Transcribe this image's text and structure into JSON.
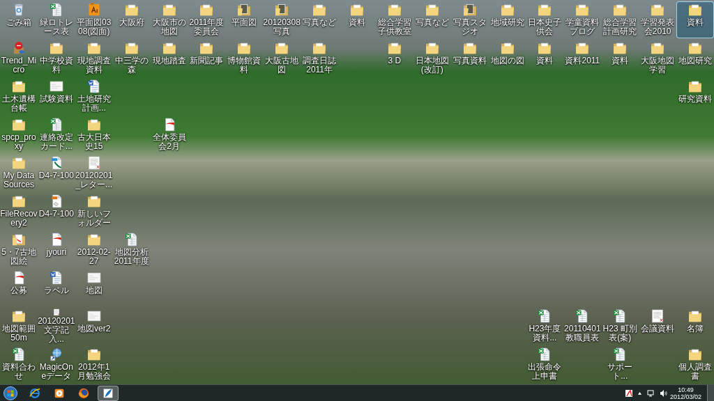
{
  "desktop": {
    "rows": [
      [
        {
          "kind": "recycle-bin",
          "label": "ごみ箱",
          "selected": false
        },
        {
          "kind": "excel",
          "label": "緑ロトレース表",
          "selected": false
        },
        {
          "kind": "illustrator",
          "label": "平面図0308(図面)",
          "selected": false
        },
        {
          "kind": "folder",
          "label": "大阪府",
          "selected": false
        },
        {
          "kind": "folder",
          "label": "大阪市の地図",
          "selected": false
        },
        {
          "kind": "folder",
          "label": "2011年度委員会",
          "selected": false
        },
        {
          "kind": "photo-folder",
          "label": "平面図",
          "selected": false
        },
        {
          "kind": "photo-folder",
          "label": "20120308写真",
          "selected": false
        },
        {
          "kind": "folder",
          "label": "写真など",
          "selected": false
        },
        {
          "kind": "folder",
          "label": "資料",
          "selected": false
        },
        {
          "kind": "folder",
          "label": "総合学習子供教室",
          "selected": false
        },
        {
          "kind": "folder",
          "label": "写真など",
          "selected": false
        },
        {
          "kind": "photo-folder",
          "label": "写真スタジオ",
          "selected": false
        },
        {
          "kind": "folder",
          "label": "地域研究",
          "selected": false
        },
        {
          "kind": "folder",
          "label": "日本史子供会",
          "selected": false
        },
        {
          "kind": "folder",
          "label": "学童資料ブログ",
          "selected": false
        },
        {
          "kind": "folder",
          "label": "総合学習計画研究",
          "selected": false
        },
        {
          "kind": "folder",
          "label": "学習発表会2010",
          "selected": false
        },
        {
          "kind": "folder",
          "label": "資料",
          "selected": true
        }
      ],
      [
        {
          "kind": "installer",
          "label": "Trend_Micro",
          "selected": false
        },
        {
          "kind": "folder",
          "label": "中学校資料",
          "selected": false
        },
        {
          "kind": "folder",
          "label": "現地調査資料",
          "selected": false
        },
        {
          "kind": "folder",
          "label": "中三学の森",
          "selected": false
        },
        {
          "kind": "folder",
          "label": "現地踏査",
          "selected": false
        },
        {
          "kind": "folder",
          "label": "新聞記事",
          "selected": false
        },
        {
          "kind": "folder",
          "label": "博物館資料",
          "selected": false
        },
        {
          "kind": "folder",
          "label": "大阪古地図",
          "selected": false
        },
        {
          "kind": "folder",
          "label": "調査日誌2011年",
          "selected": false
        },
        {
          "kind": "empty"
        },
        {
          "kind": "folder",
          "label": "3 D",
          "selected": false
        },
        {
          "kind": "folder",
          "label": "日本地図(改訂)",
          "selected": false
        },
        {
          "kind": "folder",
          "label": "写真資料",
          "selected": false
        },
        {
          "kind": "folder",
          "label": "地図の図",
          "selected": false
        },
        {
          "kind": "folder",
          "label": "資料",
          "selected": false
        },
        {
          "kind": "folder",
          "label": "資料2011",
          "selected": false
        },
        {
          "kind": "folder",
          "label": "資料",
          "selected": false
        },
        {
          "kind": "folder",
          "label": "大阪地図学習",
          "selected": false
        },
        {
          "kind": "folder",
          "label": "地図研究",
          "selected": false
        }
      ],
      [
        {
          "kind": "folder",
          "label": "土木遺構台帳",
          "selected": false
        },
        {
          "kind": "image",
          "label": "試験資料",
          "selected": false
        },
        {
          "kind": "word",
          "label": "土地研究計画...",
          "selected": false
        },
        {
          "kind": "empty"
        },
        {
          "kind": "empty"
        },
        {
          "kind": "empty"
        },
        {
          "kind": "empty"
        },
        {
          "kind": "empty"
        },
        {
          "kind": "empty"
        },
        {
          "kind": "empty"
        },
        {
          "kind": "empty"
        },
        {
          "kind": "empty"
        },
        {
          "kind": "empty"
        },
        {
          "kind": "empty"
        },
        {
          "kind": "empty"
        },
        {
          "kind": "empty"
        },
        {
          "kind": "empty"
        },
        {
          "kind": "empty"
        },
        {
          "kind": "folder",
          "label": "研究資料",
          "selected": false
        }
      ],
      [
        {
          "kind": "folder",
          "label": "spcp_proxy",
          "selected": false
        },
        {
          "kind": "excel",
          "label": "連絡改定カード...",
          "selected": false
        },
        {
          "kind": "folder",
          "label": "古大日本史15",
          "selected": false
        },
        {
          "kind": "empty"
        },
        {
          "kind": "pdf",
          "label": "全体委員会2月",
          "selected": false
        }
      ],
      [
        {
          "kind": "folder",
          "label": "My Data Sources",
          "selected": false
        },
        {
          "kind": "vector",
          "label": "D4-7-100",
          "selected": false
        },
        {
          "kind": "pdf-document",
          "label": "20120201_レター...",
          "selected": false
        }
      ],
      [
        {
          "kind": "folder",
          "label": "FileRecovery2",
          "selected": false
        },
        {
          "kind": "eps",
          "label": "D4-7-100",
          "selected": false
        },
        {
          "kind": "folder",
          "label": "新しいフォルダー",
          "selected": false
        }
      ],
      [
        {
          "kind": "pdf-folder",
          "label": "5・7古地図絵",
          "selected": false
        },
        {
          "kind": "pdf",
          "label": "jyouri",
          "selected": false
        },
        {
          "kind": "folder",
          "label": "2012-02-27",
          "selected": false
        },
        {
          "kind": "excel",
          "label": "地図分析2011年度",
          "selected": false
        }
      ],
      [
        {
          "kind": "pdf",
          "label": "公募",
          "selected": false
        },
        {
          "kind": "word",
          "label": "ラベル",
          "selected": false
        },
        {
          "kind": "image",
          "label": "地図",
          "selected": false
        }
      ],
      [
        {
          "kind": "folder",
          "label": "地図範囲50m",
          "selected": false
        },
        {
          "kind": "pdf-document",
          "label": "20120201文字記入...",
          "selected": false
        },
        {
          "kind": "image",
          "label": "地図ver2",
          "selected": false
        },
        {
          "kind": "empty"
        },
        {
          "kind": "empty"
        },
        {
          "kind": "empty"
        },
        {
          "kind": "empty"
        },
        {
          "kind": "empty"
        },
        {
          "kind": "empty"
        },
        {
          "kind": "empty"
        },
        {
          "kind": "empty"
        },
        {
          "kind": "empty"
        },
        {
          "kind": "empty"
        },
        {
          "kind": "empty"
        },
        {
          "kind": "excel",
          "label": "H23年度資料...",
          "selected": false
        },
        {
          "kind": "excel",
          "label": "20110401 教職員表",
          "selected": false
        },
        {
          "kind": "excel",
          "label": "H23 町別表(案)",
          "selected": false
        },
        {
          "kind": "pdf-document",
          "label": "会議資料",
          "selected": false
        },
        {
          "kind": "folder",
          "label": "名簿",
          "selected": false
        }
      ],
      [
        {
          "kind": "excel",
          "label": "資料合わせ",
          "selected": false
        },
        {
          "kind": "shortcut",
          "label": "MagicOneデータ",
          "selected": false
        },
        {
          "kind": "folder",
          "label": "2012年1月勉強会",
          "selected": false
        },
        {
          "kind": "empty"
        },
        {
          "kind": "empty"
        },
        {
          "kind": "empty"
        },
        {
          "kind": "empty"
        },
        {
          "kind": "empty"
        },
        {
          "kind": "empty"
        },
        {
          "kind": "empty"
        },
        {
          "kind": "empty"
        },
        {
          "kind": "empty"
        },
        {
          "kind": "empty"
        },
        {
          "kind": "empty"
        },
        {
          "kind": "excel",
          "label": "出張命令上申書",
          "selected": false
        },
        {
          "kind": "empty"
        },
        {
          "kind": "excel",
          "label": "サポート...",
          "selected": false
        },
        {
          "kind": "empty"
        },
        {
          "kind": "folder",
          "label": "個人調査書",
          "selected": false
        }
      ]
    ]
  },
  "taskbar": {
    "apps": [
      {
        "kind": "browser",
        "selected": false
      },
      {
        "kind": "media-player",
        "selected": false
      },
      {
        "kind": "firefox",
        "selected": false
      },
      {
        "kind": "feather-app",
        "selected": true
      }
    ],
    "tray": {
      "icons": [
        {
          "kind": "acrobat"
        },
        {
          "kind": "overflow"
        },
        {
          "kind": "network"
        },
        {
          "kind": "volume"
        }
      ],
      "time": "10:49",
      "date": "2012/03/02"
    }
  }
}
